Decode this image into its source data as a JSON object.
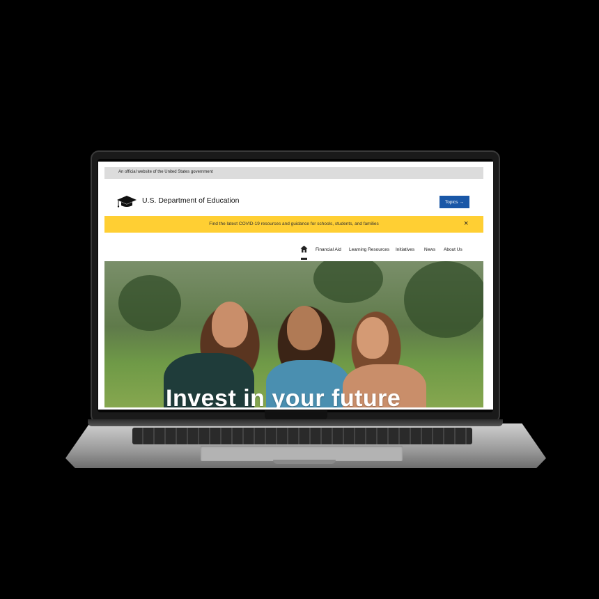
{
  "gov_banner": {
    "text": "An official website of the United States government"
  },
  "header": {
    "site_name": "U.S. Department of Education",
    "logo_icon": "graduation-cap-icon",
    "topics_label": "Topics",
    "topics_arrow": "→"
  },
  "alert": {
    "text": "Find the latest COVID-19 resources and guidance for schools, students, and families",
    "close_symbol": "×"
  },
  "nav": {
    "home_icon": "home-icon",
    "items": [
      {
        "label": "Financial Aid"
      },
      {
        "label": "Learning Resources"
      },
      {
        "label": "Initiatives"
      },
      {
        "label": "News"
      },
      {
        "label": "About Us"
      }
    ]
  },
  "hero": {
    "title": "Invest in your future"
  },
  "colors": {
    "alert_bg": "#ffcf33",
    "button_bg": "#1957a7",
    "gov_banner_bg": "#dcdcdc"
  }
}
